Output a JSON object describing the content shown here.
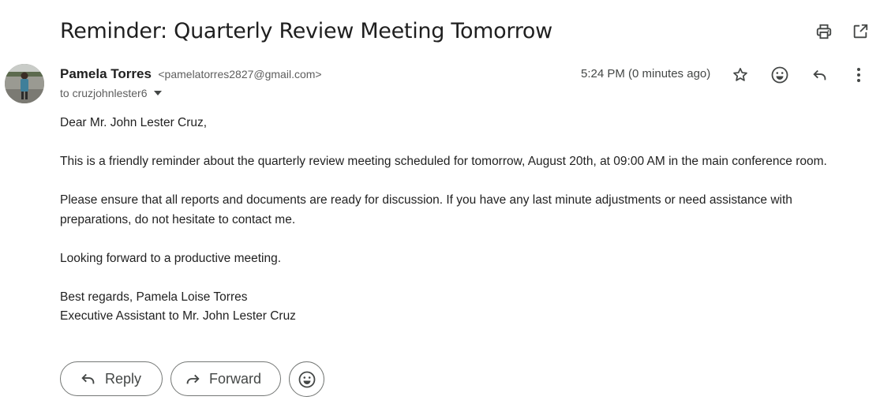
{
  "email": {
    "subject": "Reminder: Quarterly Review Meeting Tomorrow",
    "sender_name": "Pamela Torres",
    "sender_email": "<pamelatorres2827@gmail.com>",
    "recipient": "to cruzjohnlester6",
    "time": "5:24 PM (0 minutes ago)",
    "body": {
      "greeting": "Dear Mr. John Lester Cruz,",
      "paragraph1": "This is a friendly reminder about the quarterly review meeting scheduled for tomorrow, August 20th, at 09:00 AM in the main conference room.",
      "paragraph2_line1": "Please ensure that all reports and documents are ready for discussion. If you have any last minute adjustments or need assistance with",
      "paragraph2_line2": "preparations, do not hesitate to contact me.",
      "paragraph3": "Looking forward to a productive meeting.",
      "signoff": "Best regards, Pamela Loise Torres",
      "signature_title": "Executive Assistant to Mr. John Lester Cruz"
    }
  },
  "actions": {
    "reply_label": "Reply",
    "forward_label": "Forward"
  },
  "icons": {
    "print": "print-icon",
    "open_new_window": "open-in-new-window-icon",
    "star": "star-icon",
    "emoji": "emoji-icon",
    "reply": "reply-icon",
    "more": "more-vert-icon",
    "caret": "caret-down-icon",
    "forward": "forward-icon"
  },
  "colors": {
    "text_primary": "#1f1f1f",
    "text_secondary": "#5e5e5e",
    "icon": "#444746",
    "button_border": "#747775"
  }
}
